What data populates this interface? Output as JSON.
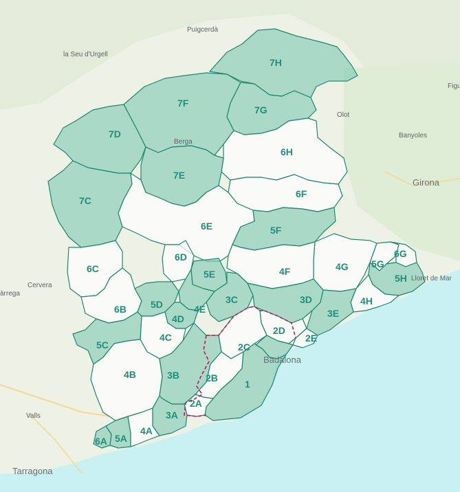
{
  "colors": {
    "land": "#eef0e6",
    "sea": "#c9f1f1",
    "zone_tint": "#7fc9b4",
    "zone_border": "#1a8a6e",
    "label": "#1e8f78",
    "dashed_border": "#c2185b"
  },
  "places": [
    {
      "key": "puigcerda",
      "name": "Puigcerdà"
    },
    {
      "key": "seu",
      "name": "la Seu d'Urgell"
    },
    {
      "key": "olot",
      "name": "Olot"
    },
    {
      "key": "banyoles",
      "name": "Banyoles"
    },
    {
      "key": "girona",
      "name": "Girona"
    },
    {
      "key": "figueres",
      "name": "Figu"
    },
    {
      "key": "berga",
      "name": "Berga"
    },
    {
      "key": "cervera",
      "name": "Cervera"
    },
    {
      "key": "tarrega",
      "name": "àrrega"
    },
    {
      "key": "lloret",
      "name": "Lloret de Mar"
    },
    {
      "key": "badalona",
      "name": "Badalona"
    },
    {
      "key": "valls",
      "name": "Valls"
    },
    {
      "key": "tarragona",
      "name": "Tarragona"
    }
  ],
  "zones": [
    "7H",
    "7F",
    "7G",
    "7D",
    "6H",
    "7E",
    "6F",
    "7C",
    "6E",
    "5F",
    "6D",
    "6C",
    "5G",
    "6G",
    "5E",
    "4G",
    "4F",
    "5H",
    "3C",
    "3D",
    "6B",
    "5D",
    "4E",
    "4H",
    "4D",
    "3E",
    "4C",
    "2D",
    "2E",
    "5C",
    "2C",
    "Badalona",
    "4B",
    "3B",
    "2B",
    "1",
    "2A",
    "3A",
    "6A",
    "5A",
    "4A"
  ]
}
